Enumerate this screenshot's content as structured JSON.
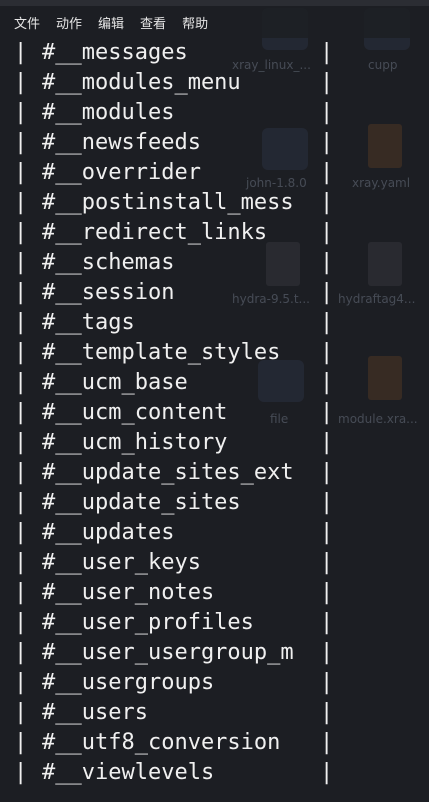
{
  "menu": {
    "items": [
      "文件",
      "动作",
      "编辑",
      "查看",
      "帮助"
    ]
  },
  "desktop_ghost": {
    "labels": [
      "xray_linux_...",
      "cupp",
      "john-1.8.0",
      "xray.yaml",
      "hydra-9.5.t...",
      "hydraftag4...",
      "file",
      "module.xra..."
    ]
  },
  "table": {
    "rows": [
      "#__messages",
      "#__modules_menu",
      "#__modules",
      "#__newsfeeds",
      "#__overrider",
      "#__postinstall_mess",
      "#__redirect_links",
      "#__schemas",
      "#__session",
      "#__tags",
      "#__template_styles",
      "#__ucm_base",
      "#__ucm_content",
      "#__ucm_history",
      "#__update_sites_ext",
      "#__update_sites",
      "#__updates",
      "#__user_keys",
      "#__user_notes",
      "#__user_profiles",
      "#__user_usergroup_m",
      "#__usergroups",
      "#__users",
      "#__utf8_conversion",
      "#__viewlevels"
    ]
  },
  "colors": {
    "background": "#1c1e23",
    "text": "#f0f0f0"
  }
}
